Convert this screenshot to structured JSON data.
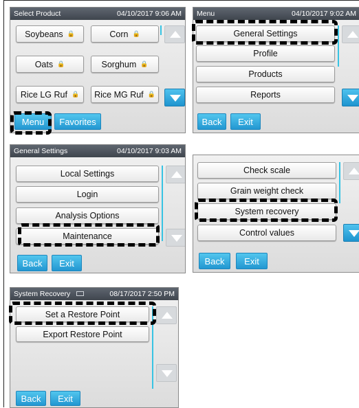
{
  "screen_select_product": {
    "title": "Select Product",
    "datetime": "04/10/2017 9:06 AM",
    "products": [
      {
        "label": "Soybeans"
      },
      {
        "label": "Corn"
      },
      {
        "label": "Oats"
      },
      {
        "label": "Sorghum"
      },
      {
        "label": "Rice LG Ruf"
      },
      {
        "label": "Rice MG Ruf"
      }
    ],
    "menu_label": "Menu",
    "favorites_label": "Favorites"
  },
  "screen_menu": {
    "title": "Menu",
    "datetime": "04/10/2017 9:02 AM",
    "items": [
      {
        "label": "General Settings"
      },
      {
        "label": "Profile"
      },
      {
        "label": "Products"
      },
      {
        "label": "Reports"
      }
    ],
    "back_label": "Back",
    "exit_label": "Exit"
  },
  "screen_general_settings": {
    "title": "General Settings",
    "datetime": "04/10/2017 9:03 AM",
    "items": [
      {
        "label": "Local Settings"
      },
      {
        "label": "Login"
      },
      {
        "label": "Analysis Options"
      },
      {
        "label": "Maintenance"
      }
    ],
    "back_label": "Back",
    "exit_label": "Exit"
  },
  "screen_maintenance": {
    "items": [
      {
        "label": "Check scale"
      },
      {
        "label": "Grain weight check"
      },
      {
        "label": "System recovery"
      },
      {
        "label": "Control values"
      }
    ],
    "back_label": "Back",
    "exit_label": "Exit"
  },
  "screen_system_recovery": {
    "title": "System Recovery",
    "datetime": "08/17/2017 2:50 PM",
    "items": [
      {
        "label": "Set a Restore Point"
      },
      {
        "label": "Export Restore Point"
      }
    ],
    "back_label": "Back",
    "exit_label": "Exit"
  },
  "colors": {
    "titlebar": "#4a5058",
    "accent_blue": "#2aa3dc",
    "highlight": "#000000"
  }
}
